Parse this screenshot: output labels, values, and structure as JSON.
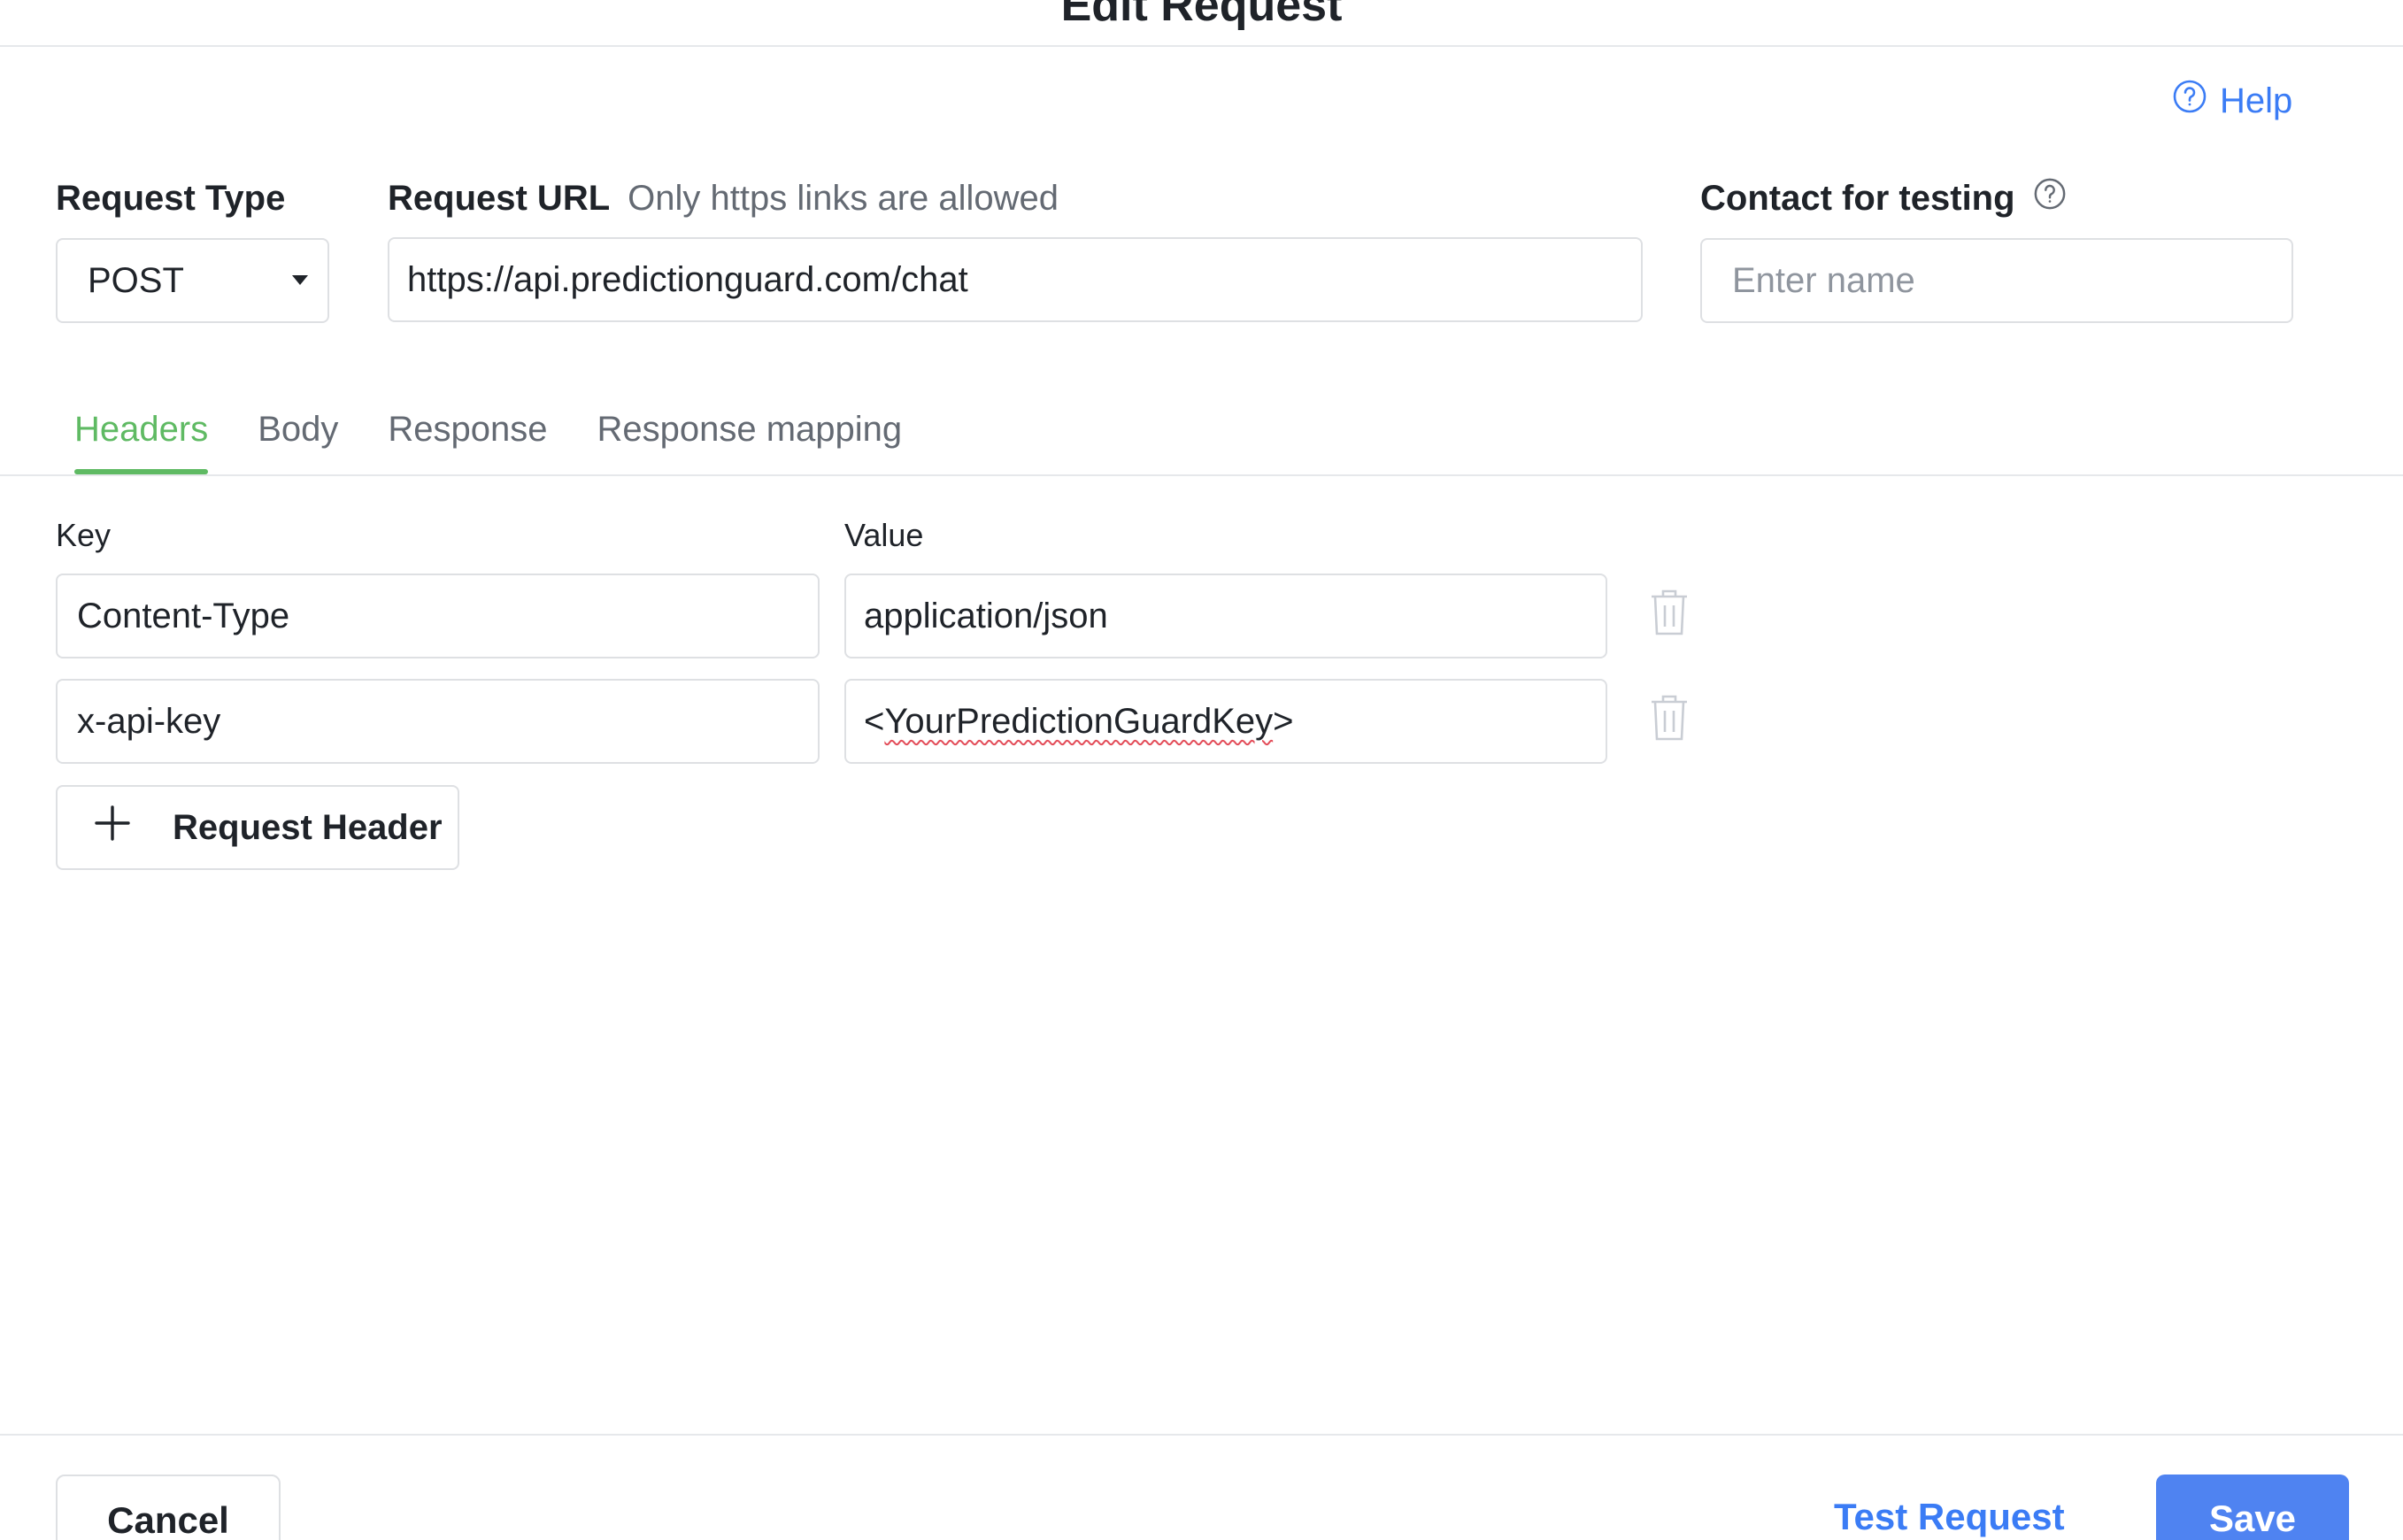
{
  "modal": {
    "title": "Edit Request"
  },
  "help": {
    "label": "Help",
    "icon": "help-circle-icon"
  },
  "request_type": {
    "label": "Request Type",
    "value": "POST",
    "icon": "caret-down-icon"
  },
  "request_url": {
    "label": "Request URL",
    "hint": "Only https links are allowed",
    "value": "https://api.predictionguard.com/chat"
  },
  "contact": {
    "label": "Contact for testing",
    "placeholder": "Enter name",
    "icon": "help-circle-icon"
  },
  "tabs": [
    {
      "label": "Headers",
      "active": true
    },
    {
      "label": "Body",
      "active": false
    },
    {
      "label": "Response",
      "active": false
    },
    {
      "label": "Response mapping",
      "active": false
    }
  ],
  "headers": {
    "key_label": "Key",
    "value_label": "Value",
    "rows": [
      {
        "key": "Content-Type",
        "value": "application/json"
      },
      {
        "key": "x-api-key",
        "value_prefix": "<",
        "value_word": "YourPredictionGuardKey",
        "value_suffix": ">"
      }
    ],
    "add_label": "Request Header"
  },
  "footer": {
    "cancel_label": "Cancel",
    "test_label": "Test Request",
    "save_label": "Save"
  },
  "colors": {
    "accent_blue": "#3b7cf5",
    "primary_button": "#4f83f1",
    "active_tab": "#5fba63",
    "border": "#dee0e3",
    "spellcheck": "#e34d59"
  }
}
